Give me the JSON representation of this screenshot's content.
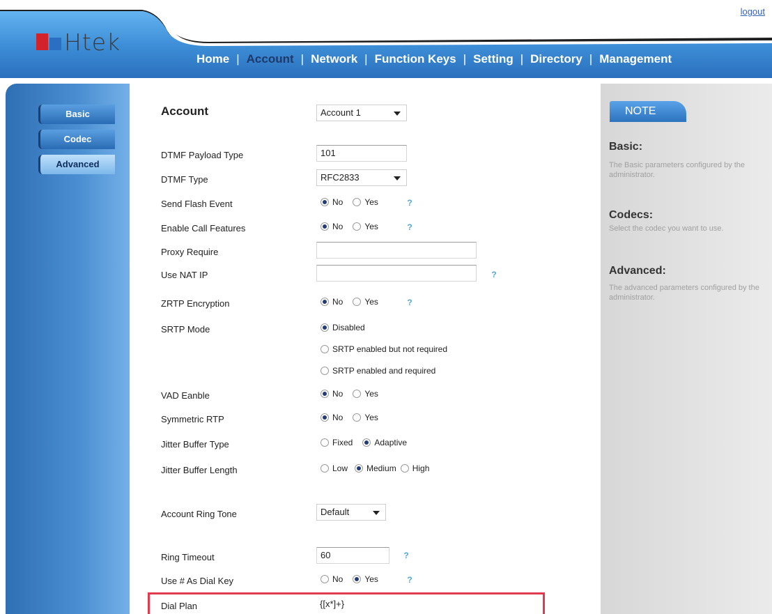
{
  "header": {
    "logout_label": "logout",
    "logo_text": "Htek",
    "nav": [
      {
        "label": "Home"
      },
      {
        "label": "Account"
      },
      {
        "label": "Network"
      },
      {
        "label": "Function Keys"
      },
      {
        "label": "Setting"
      },
      {
        "label": "Directory"
      },
      {
        "label": "Management"
      }
    ],
    "active_nav": "Account"
  },
  "sidebar": {
    "tabs": [
      {
        "label": "Basic"
      },
      {
        "label": "Codec"
      },
      {
        "label": "Advanced"
      }
    ],
    "active": "Advanced"
  },
  "form": {
    "account": {
      "label": "Account",
      "value": "Account 1"
    },
    "dtmf_payload": {
      "label": "DTMF Payload Type",
      "value": "101"
    },
    "dtmf_type": {
      "label": "DTMF Type",
      "value": "RFC2833"
    },
    "send_flash": {
      "label": "Send Flash Event",
      "options": [
        "No",
        "Yes"
      ],
      "selected": "No"
    },
    "call_features": {
      "label": "Enable Call Features",
      "options": [
        "No",
        "Yes"
      ],
      "selected": "No"
    },
    "proxy_require": {
      "label": "Proxy Require",
      "value": ""
    },
    "nat_ip": {
      "label": "Use NAT IP",
      "value": ""
    },
    "zrtp": {
      "label": "ZRTP Encryption",
      "options": [
        "No",
        "Yes"
      ],
      "selected": "No"
    },
    "srtp": {
      "label": "SRTP Mode",
      "options": [
        "Disabled",
        "SRTP enabled but not required",
        "SRTP enabled and required"
      ],
      "selected": "Disabled"
    },
    "vad": {
      "label": "VAD Eanble",
      "options": [
        "No",
        "Yes"
      ],
      "selected": "No"
    },
    "symmetric_rtp": {
      "label": "Symmetric RTP",
      "options": [
        "No",
        "Yes"
      ],
      "selected": "No"
    },
    "jitter_type": {
      "label": "Jitter Buffer Type",
      "options": [
        "Fixed",
        "Adaptive"
      ],
      "selected": "Adaptive"
    },
    "jitter_length": {
      "label": "Jitter Buffer Length",
      "options": [
        "Low",
        "Medium",
        "High"
      ],
      "selected": "Medium"
    },
    "ring_tone": {
      "label": "Account Ring Tone",
      "value": "Default"
    },
    "ring_timeout": {
      "label": "Ring Timeout",
      "value": "60"
    },
    "dial_key": {
      "label": "Use # As Dial Key",
      "options": [
        "No",
        "Yes"
      ],
      "selected": "Yes"
    },
    "dial_plan": {
      "label": "Dial Plan",
      "value": "{[x*]+}"
    }
  },
  "help_glyph": "?",
  "note": {
    "title": "NOTE",
    "sections": [
      {
        "heading": "Basic:",
        "text": "The Basic parameters configured by the administrator."
      },
      {
        "heading": "Codecs:",
        "text": "Select the codec you want to use."
      },
      {
        "heading": "Advanced:",
        "text": "The advanced parameters configured by the administrator."
      }
    ]
  },
  "colors": {
    "header_blue": "#3d8ed8",
    "sidebar_blue": "#2f6fb3",
    "highlight_red": "#e23b4f",
    "radio_fill": "#243c74"
  }
}
